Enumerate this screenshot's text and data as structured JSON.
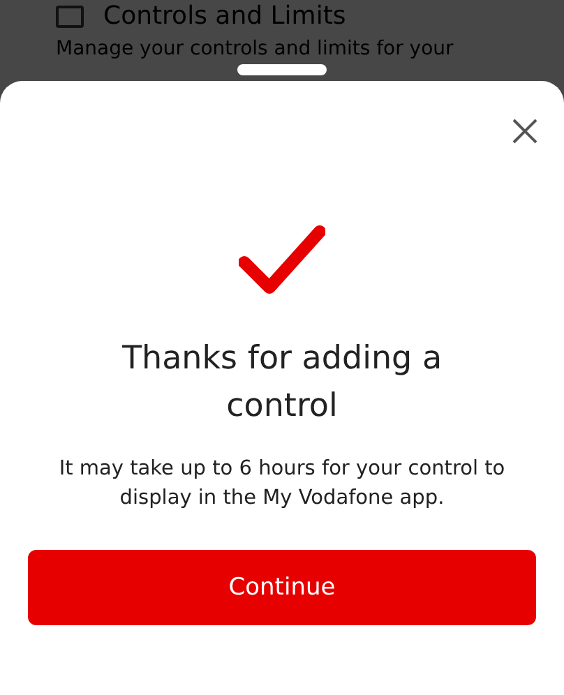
{
  "background": {
    "title": "Controls and Limits",
    "description": "Manage your controls and limits for your"
  },
  "sheet": {
    "heading": "Thanks for adding a control",
    "message": "It may take up to 6 hours for your control to display in the My Vodafone app.",
    "button": "Continue"
  }
}
